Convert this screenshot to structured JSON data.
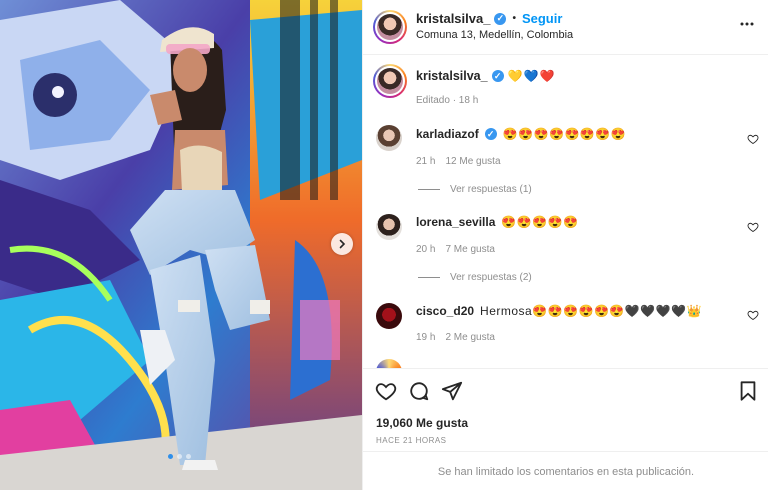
{
  "post": {
    "username": "kristalsilva_",
    "follow_label": "Seguir",
    "location": "Comuna 13, Medellín, Colombia",
    "caption_emojis": "💛💙❤️",
    "caption_meta": "Editado · 18 h"
  },
  "comments": [
    {
      "user": "karladiazof",
      "verified": true,
      "text": "😍😍😍😍😍😍😍😍",
      "time": "21 h",
      "likes": "12 Me gusta",
      "replies": "Ver respuestas (1)"
    },
    {
      "user": "lorena_sevilla",
      "verified": false,
      "text": "😍😍😍😍😍",
      "time": "20 h",
      "likes": "7 Me gusta",
      "replies": "Ver respuestas (2)"
    },
    {
      "user": "cisco_d20",
      "verified": false,
      "text": "Hermosa😍😍😍😍😍😍🖤🖤🖤🖤👑",
      "time": "19 h",
      "likes": "2 Me gusta",
      "replies": ""
    }
  ],
  "footer": {
    "likes": "19,060 Me gusta",
    "time_ago": "HACE 21 HORAS",
    "comments_limited": "Se han limitado los comentarios en esta publicación."
  },
  "carousel": {
    "count": 3,
    "active": 0
  },
  "icons": [
    "verified-icon",
    "more-icon",
    "heart-icon",
    "comment-icon",
    "share-icon",
    "bookmark-icon",
    "chevron-right-icon"
  ],
  "colors": {
    "link": "#0095f6",
    "verified": "#3897f0",
    "muted": "#8e8e8e"
  }
}
